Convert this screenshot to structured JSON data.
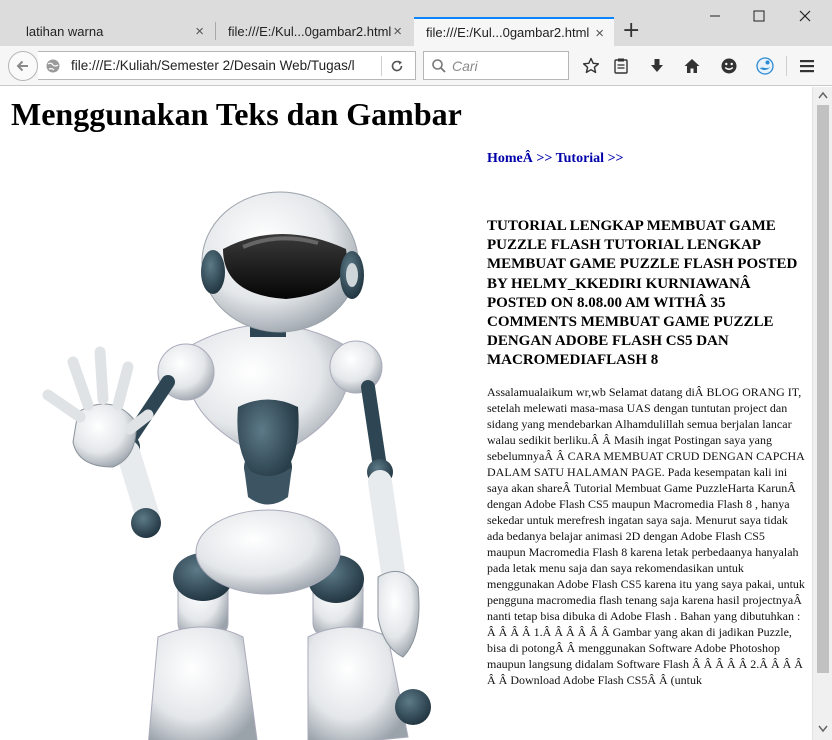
{
  "browser": {
    "tabs": [
      {
        "label": "latihan warna"
      },
      {
        "label": "file:///E:/Kul...0gambar2.html"
      },
      {
        "label": "file:///E:/Kul...0gambar2.html"
      }
    ],
    "url": "file:///E:/Kuliah/Semester 2/Desain Web/Tugas/l",
    "search_placeholder": "Cari",
    "tab_close_glyph": "×",
    "new_tab_glyph": "+"
  },
  "page": {
    "title": "Menggunakan Teks dan Gambar",
    "breadcrumb": "HomeÂ >> Tutorial >>",
    "article_heading": "TUTORIAL LENGKAP MEMBUAT GAME PUZZLE FLASH TUTORIAL LENGKAP MEMBUAT GAME PUZZLE FLASH POSTED BY HELMY_KKEDIRI KURNIAWANÂ POSTED ON 8.08.00 AM WITHÂ 35 COMMENTS MEMBUAT GAME PUZZLE DENGAN ADOBE FLASH CS5 DAN MACROMEDIAFLASH 8",
    "article_body": "Assalamualaikum wr,wb Selamat datang diÂ BLOG ORANG IT, setelah melewati masa-masa UAS dengan tuntutan project dan sidang yang mendebarkan Alhamdulillah semua berjalan lancar walau sedikit berliku.Â Â Masih ingat Postingan saya yang sebelumnyaÂ Â CARA MEMBUAT CRUD DENGAN CAPCHA DALAM SATU HALAMAN PAGE. Pada kesempatan kali ini saya akan shareÂ Tutorial Membuat Game PuzzleHarta KarunÂ dengan Adobe Flash CS5 maupun Macromedia Flash 8 , hanya sekedar untuk merefresh ingatan saya saja. Menurut saya tidak ada bedanya belajar animasi 2D dengan Adobe Flash CS5 maupun Macromedia Flash 8 karena letak perbedaanya hanyalah pada letak menu saja dan saya rekomendasikan untuk menggunakan Adobe Flash CS5 karena itu yang saya pakai, untuk pengguna macromedia flash tenang saja karena hasil projectnyaÂ nanti tetap bisa dibuka di Adobe Flash . Bahan yang dibutuhkan : Â Â Â  Â 1.Â Â Â Â Â Â Gambar yang akan di jadikan Puzzle, bisa di potongÂ Â menggunakan Software Adobe Photoshop maupun langsung didalam Software Flash Â Â Â Â Â 2.Â Â Â Â Â Â Download Adobe Flash CS5Â Â (untuk"
  },
  "colors": {
    "link": "#0000aa",
    "tab_accent": "#0a84ff",
    "firefox_blue": "#0a84ff"
  }
}
